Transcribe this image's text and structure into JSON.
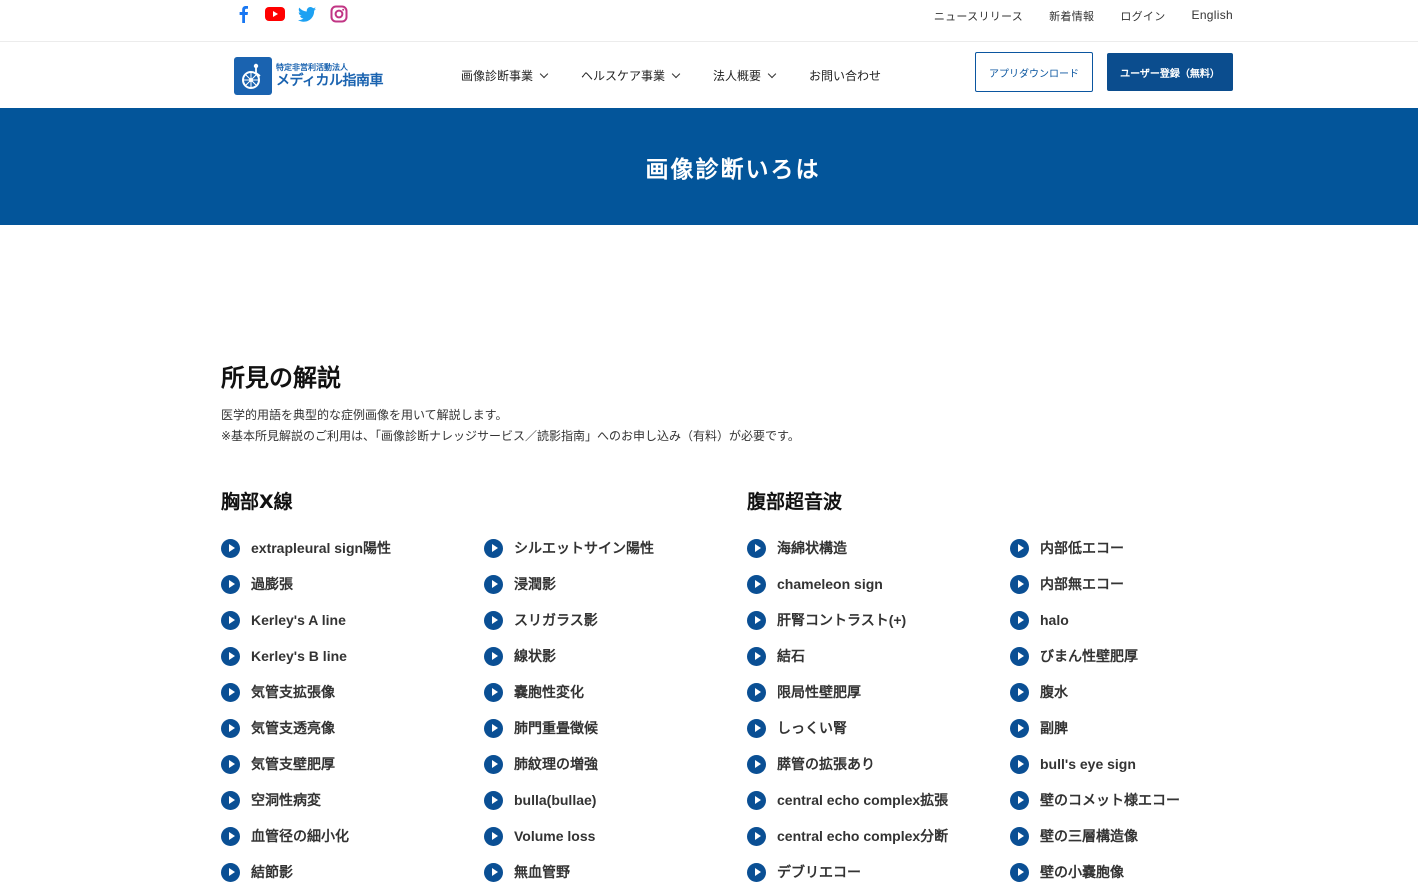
{
  "topbar": {
    "social": [
      {
        "name": "facebook-icon",
        "color": "#1877f2"
      },
      {
        "name": "youtube-icon",
        "color": "#ff0000"
      },
      {
        "name": "twitter-icon",
        "color": "#1da1f2"
      },
      {
        "name": "instagram-icon",
        "color": "#c13584"
      }
    ],
    "links": [
      "ニュースリリース",
      "新着情報",
      "ログイン",
      "English"
    ]
  },
  "header": {
    "logo_sub": "特定非営利活動法人",
    "logo_main": "メディカル指南車",
    "nav": [
      {
        "label": "画像診断事業",
        "dropdown": true
      },
      {
        "label": "ヘルスケア事業",
        "dropdown": true
      },
      {
        "label": "法人概要",
        "dropdown": true
      },
      {
        "label": "お問い合わせ",
        "dropdown": false
      }
    ],
    "btn_download": "アプリダウンロード",
    "btn_register": "ユーザー登録（無料）"
  },
  "banner": {
    "title": "画像診断いろは"
  },
  "content": {
    "section_title": "所見の解説",
    "desc_line1": "医学的用語を典型的な症例画像を用いて解説します。",
    "desc_line2": "※基本所見解説のご利用は、「画像診断ナレッジサービス／読影指南」へのお申し込み（有料）が必要です。",
    "chest_title": "胸部X線",
    "abdomen_title": "腹部超音波",
    "chest_col1": [
      "extrapleural sign陽性",
      "過膨張",
      "Kerley's A line",
      "Kerley's B line",
      "気管支拡張像",
      "気管支透亮像",
      "気管支壁肥厚",
      "空洞性病変",
      "血管径の細小化",
      "結節影"
    ],
    "chest_col2": [
      "シルエットサイン陽性",
      "浸潤影",
      "スリガラス影",
      "線状影",
      "嚢胞性変化",
      "肺門重畳徴候",
      "肺紋理の増強",
      "bulla(bullae)",
      "Volume loss",
      "無血管野"
    ],
    "abd_col1": [
      "海綿状構造",
      "chameleon sign",
      "肝腎コントラスト(+)",
      "結石",
      "限局性壁肥厚",
      "しっくい腎",
      "膵管の拡張あり",
      "central echo complex拡張",
      "central echo complex分断",
      "デブリエコー"
    ],
    "abd_col2": [
      "内部低エコー",
      "内部無エコー",
      "halo",
      "びまん性壁肥厚",
      "腹水",
      "副脾",
      "bull's eye sign",
      "壁のコメット様エコー",
      "壁の三層構造像",
      "壁の小嚢胞像"
    ],
    "accent": "#03559a"
  }
}
